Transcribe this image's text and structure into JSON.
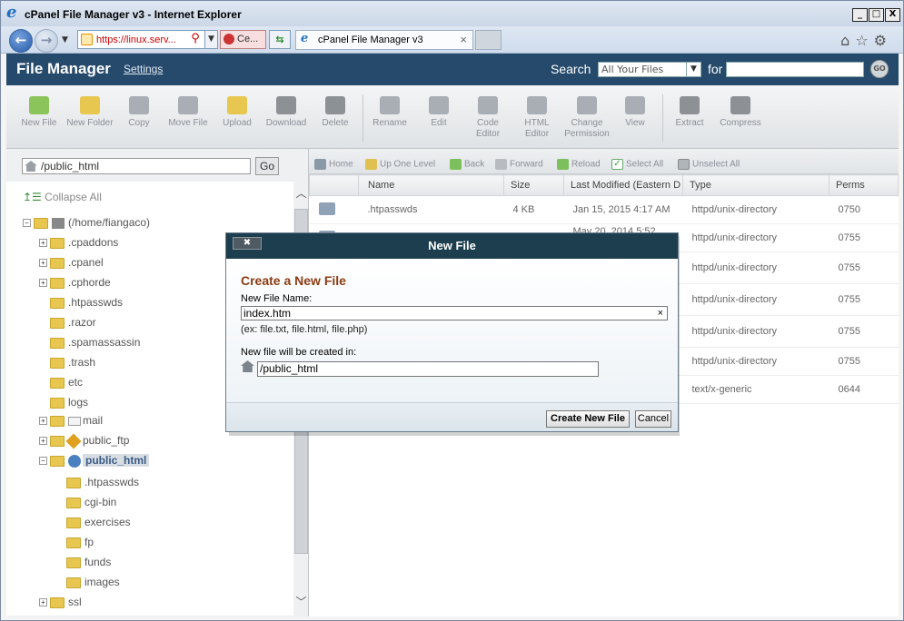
{
  "window": {
    "title": "cPanel File Manager v3 - Internet Explorer",
    "minimize": "_",
    "maximize": "□",
    "close": "X"
  },
  "browser": {
    "address": "https://linux.serv...",
    "tab2_label": "Ce...",
    "tab3_label": "cPanel File Manager v3",
    "tab_close": "×"
  },
  "header": {
    "brand": "File Manager",
    "settings": "Settings",
    "search_label": "Search",
    "search_scope": "All Your Files",
    "for_label": "for",
    "go": "GO"
  },
  "toolbar": {
    "new_file": "New File",
    "new_folder": "New Folder",
    "copy": "Copy",
    "move_file": "Move File",
    "upload": "Upload",
    "download": "Download",
    "delete": "Delete",
    "rename": "Rename",
    "edit": "Edit",
    "code_editor": "Code Editor",
    "html_editor": "HTML Editor",
    "change_permission": "Change Permission",
    "view": "View",
    "extract": "Extract",
    "compress": "Compress"
  },
  "left": {
    "path": "/public_html",
    "go": "Go",
    "collapse_all": "Collapse All",
    "root": "(/home/fiangaco)",
    "items": [
      ".cpaddons",
      ".cpanel",
      ".cphorde",
      ".htpasswds",
      ".razor",
      ".spamassassin",
      ".trash",
      "etc",
      "logs",
      "mail",
      "public_ftp",
      "public_html"
    ],
    "sub_items": [
      ".htpasswds",
      "cgi-bin",
      "exercises",
      "fp",
      "funds",
      "images"
    ],
    "last": "ssl"
  },
  "nav": {
    "home": "Home",
    "up": "Up One Level",
    "back": "Back",
    "forward": "Forward",
    "reload": "Reload",
    "select_all": "Select All",
    "unselect_all": "Unselect All"
  },
  "table": {
    "headers": [
      "Name",
      "Size",
      "Last Modified (Eastern D",
      "Type",
      "Perms"
    ],
    "rows": [
      [
        ".htpasswds",
        "4 KB",
        "Jan 15, 2015 4:17 AM",
        "httpd/unix-directory",
        "0750"
      ],
      [
        "",
        "",
        "May 20, 2014 5:52",
        "httpd/unix-directory",
        "0755"
      ],
      [
        "",
        "",
        "",
        "httpd/unix-directory",
        "0755"
      ],
      [
        "",
        "",
        "",
        "httpd/unix-directory",
        "0755"
      ],
      [
        "",
        "",
        "",
        "httpd/unix-directory",
        "0755"
      ],
      [
        "",
        "",
        "",
        "httpd/unix-directory",
        "0755"
      ],
      [
        "",
        "",
        "",
        "text/x-generic",
        "0644"
      ]
    ]
  },
  "dialog": {
    "title": "New File",
    "close": "✖",
    "heading": "Create a New File",
    "name_label": "New File Name:",
    "name_value": "index.htm",
    "clear": "×",
    "hint": "(ex: file.txt, file.html, file.php)",
    "dir_label": "New file will be created in:",
    "dir_value": "/public_html",
    "create_button": "Create New File",
    "cancel_button": "Cancel"
  }
}
